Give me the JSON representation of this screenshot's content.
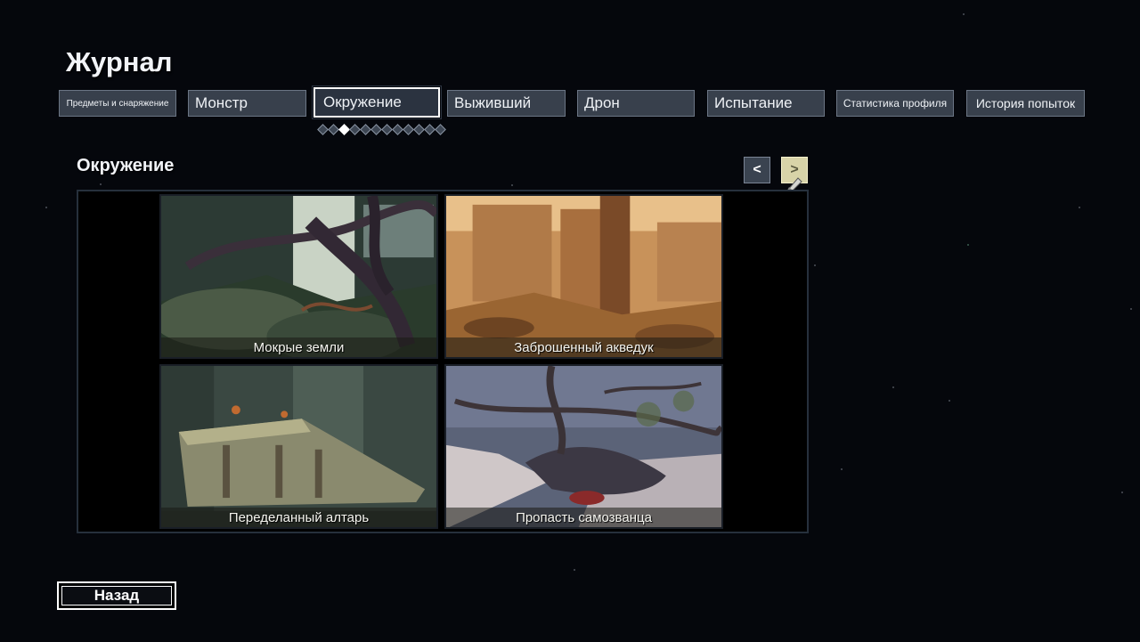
{
  "title": "Журнал",
  "tabs": [
    {
      "label": "Предметы и снаряжение"
    },
    {
      "label": "Монстр"
    },
    {
      "label": "Окружение"
    },
    {
      "label": "Выживший"
    },
    {
      "label": "Дрон"
    },
    {
      "label": "Испытание"
    },
    {
      "label": "Статистика профиля"
    },
    {
      "label": "История попыток"
    }
  ],
  "active_tab": "Окружение",
  "pager": {
    "total": 12,
    "current": 3
  },
  "section_title": "Окружение",
  "nav": {
    "prev_label": "<",
    "next_label": ">"
  },
  "environments": [
    {
      "label": "Мокрые земли"
    },
    {
      "label": "Заброшенный акведук"
    },
    {
      "label": "Переделанный алтарь"
    },
    {
      "label": "Пропасть самозванца"
    }
  ],
  "back_label": "Назад",
  "colors": {
    "background": "#05070c",
    "tab": "#38404c",
    "tab_border": "#6b7584",
    "next_button": "#d8d3a8"
  }
}
